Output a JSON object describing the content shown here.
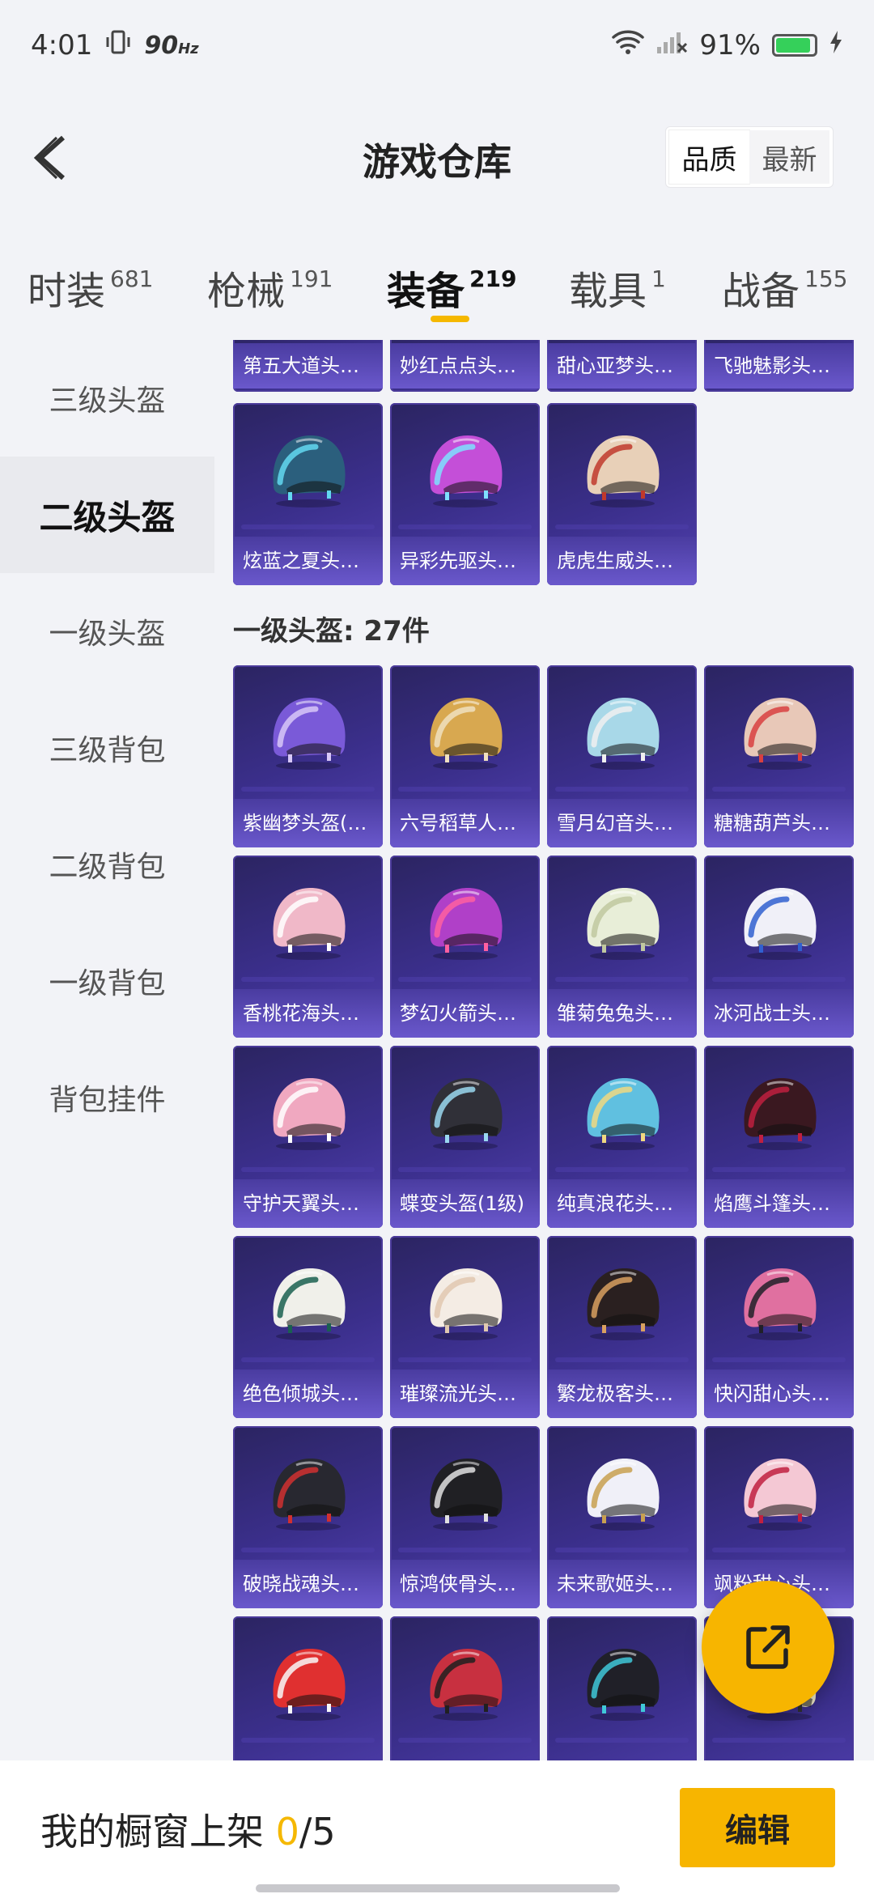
{
  "status_bar": {
    "time": "4:01",
    "refresh_rate": "90",
    "refresh_unit": "Hz",
    "battery": "91%",
    "battery_level": 0.91
  },
  "header": {
    "title": "游戏仓库",
    "sort_options": [
      "品质",
      "最新"
    ],
    "sort_selected": "品质"
  },
  "tabs": [
    {
      "label": "时装",
      "count": "681"
    },
    {
      "label": "枪械",
      "count": "191"
    },
    {
      "label": "装备",
      "count": "219",
      "active": true
    },
    {
      "label": "载具",
      "count": "1"
    },
    {
      "label": "战备",
      "count": "155"
    }
  ],
  "sidebar": {
    "items": [
      "三级头盔",
      "二级头盔",
      "一级头盔",
      "三级背包",
      "二级背包",
      "一级背包",
      "背包挂件"
    ],
    "active": "二级头盔"
  },
  "top_partial_row": [
    "第五大道头盔...",
    "妙红点点头盔...",
    "甜心亚梦头盔...",
    "飞驰魅影头盔..."
  ],
  "level2_items": [
    {
      "name": "炫蓝之夏头盔...",
      "color": "#2b5f7d",
      "accent": "#63d8f0"
    },
    {
      "name": "异彩先驱头盔...",
      "color": "#c44fd8",
      "accent": "#7ee0ff"
    },
    {
      "name": "虎虎生威头盔...",
      "color": "#e8d0b8",
      "accent": "#c0392b"
    }
  ],
  "level1_section": {
    "title": "一级头盔: 27件",
    "items": [
      {
        "name": "紫幽梦头盔(1...",
        "color": "#7a5ad8",
        "accent": "#d8c8f8"
      },
      {
        "name": "六号稻草人头...",
        "color": "#d8a850",
        "accent": "#f0e0c0"
      },
      {
        "name": "雪月幻音头盔...",
        "color": "#a8d8e8",
        "accent": "#f0f0f0"
      },
      {
        "name": "糖糖葫芦头盔...",
        "color": "#e8c8b8",
        "accent": "#d84040"
      },
      {
        "name": "香桃花海头盔...",
        "color": "#f0b8c8",
        "accent": "#ffffff"
      },
      {
        "name": "梦幻火箭头盔...",
        "color": "#b040c8",
        "accent": "#ff60a0"
      },
      {
        "name": "雏菊兔兔头盔...",
        "color": "#e8eed8",
        "accent": "#c0c8a0"
      },
      {
        "name": "冰河战士头盔...",
        "color": "#f0f0f8",
        "accent": "#3060d0"
      },
      {
        "name": "守护天翼头盔...",
        "color": "#f0a8c0",
        "accent": "#ffffff"
      },
      {
        "name": "蝶变头盔(1级)",
        "color": "#303038",
        "accent": "#9ad8f0"
      },
      {
        "name": "纯真浪花头盔...",
        "color": "#60c0e0",
        "accent": "#f0d880"
      },
      {
        "name": "焰鹰斗篷头盔...",
        "color": "#3a1820",
        "accent": "#c02040"
      },
      {
        "name": "绝色倾城头盔...",
        "color": "#f0f0ea",
        "accent": "#1a6050"
      },
      {
        "name": "璀璨流光头盔...",
        "color": "#f4ece4",
        "accent": "#e0c8b0"
      },
      {
        "name": "繁龙极客头盔...",
        "color": "#2a2020",
        "accent": "#d8a060"
      },
      {
        "name": "快闪甜心头盔...",
        "color": "#e070a0",
        "accent": "#202028"
      },
      {
        "name": "破晓战魂头盔...",
        "color": "#282830",
        "accent": "#d03030"
      },
      {
        "name": "惊鸿侠骨头盔...",
        "color": "#202024",
        "accent": "#e0e0e0"
      },
      {
        "name": "未来歌姬头盔...",
        "color": "#f0f0f8",
        "accent": "#c8a050"
      },
      {
        "name": "飒粉甜心头盔...",
        "color": "#f4c8d4",
        "accent": "#c02040"
      },
      {
        "name": "",
        "color": "#e03030",
        "accent": "#f8f8f8"
      },
      {
        "name": "",
        "color": "#c83040",
        "accent": "#202020"
      },
      {
        "name": "",
        "color": "#202028",
        "accent": "#40c8d8"
      },
      {
        "name": "",
        "color": "#f0e8c8",
        "accent": "#303030"
      }
    ]
  },
  "bottom_bar": {
    "label": "我的橱窗上架",
    "count": "0",
    "total": "/5",
    "edit_label": "编辑"
  },
  "icons": {
    "back": "back-arrow-icon",
    "share": "share-out-icon",
    "wifi": "wifi-icon",
    "signal": "signal-icon",
    "vibrate": "vibrate-icon",
    "battery": "battery-icon"
  },
  "accent_color": "#f7b500"
}
